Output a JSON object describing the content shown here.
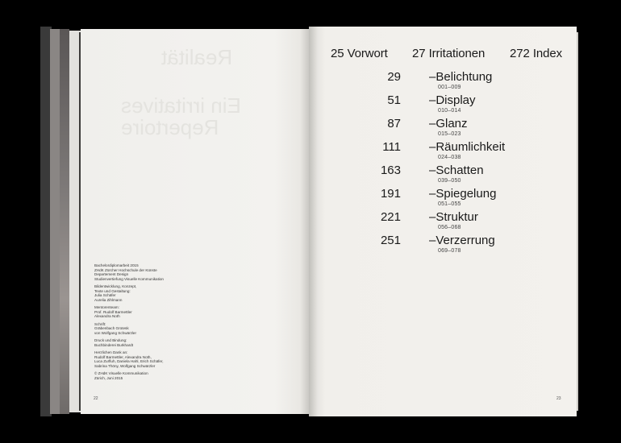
{
  "toc": {
    "top_entries": [
      {
        "page": "25",
        "label": "Vorwort"
      },
      {
        "page": "27",
        "label": "Irritationen"
      },
      {
        "page": "272",
        "label": "Index"
      }
    ],
    "chapters": [
      {
        "page": "29",
        "title": "–Belichtung",
        "range": "001–009"
      },
      {
        "page": "51",
        "title": "–Display",
        "range": "010–014"
      },
      {
        "page": "87",
        "title": "–Glanz",
        "range": "015–023"
      },
      {
        "page": "111",
        "title": "–Räumlichkeit",
        "range": "024–038"
      },
      {
        "page": "163",
        "title": "–Schatten",
        "range": "039–050"
      },
      {
        "page": "191",
        "title": "–Spiegelung",
        "range": "051–055"
      },
      {
        "page": "221",
        "title": "–Struktur",
        "range": "056–068"
      },
      {
        "page": "251",
        "title": "–Verzerrung",
        "range": "069–078"
      }
    ]
  },
  "colophon": [
    "Bachelordiplomarbeit 2015\nZHdK Zürcher Hochschule der Künste\nDepartement Design\nStudienvertiefung Visuelle Kommunikation",
    "Bildentwicklung, Konzept,\nTexte und Gestaltung:\nJulia Schäfer\nAurelia Zihlmann",
    "Mentorenteam:\nProf. Rudolf Barmettler\nAlexandra Noth",
    "Schrift:\nGräbenbach Grotesk\nvon Wolfgang Schwärzler",
    "Druck und Bindung:\nBuchbinderei Burkhardt",
    "Herzlichen Dank an:\nRudolf Barmettler, Alexandra Noth,\nLuca Zurfluh, Daniela Hahl, Erich Schäfer,\nSabrina Thöny, Wolfgang Schwärzler",
    "© ZHdK Visuelle Kommunikation\nZürich, Juni 2015"
  ],
  "show_through": {
    "title_1": "Realität",
    "title_2": "Ein irritatives\nRepertoire"
  },
  "folios": {
    "left": "22",
    "right": "23"
  }
}
